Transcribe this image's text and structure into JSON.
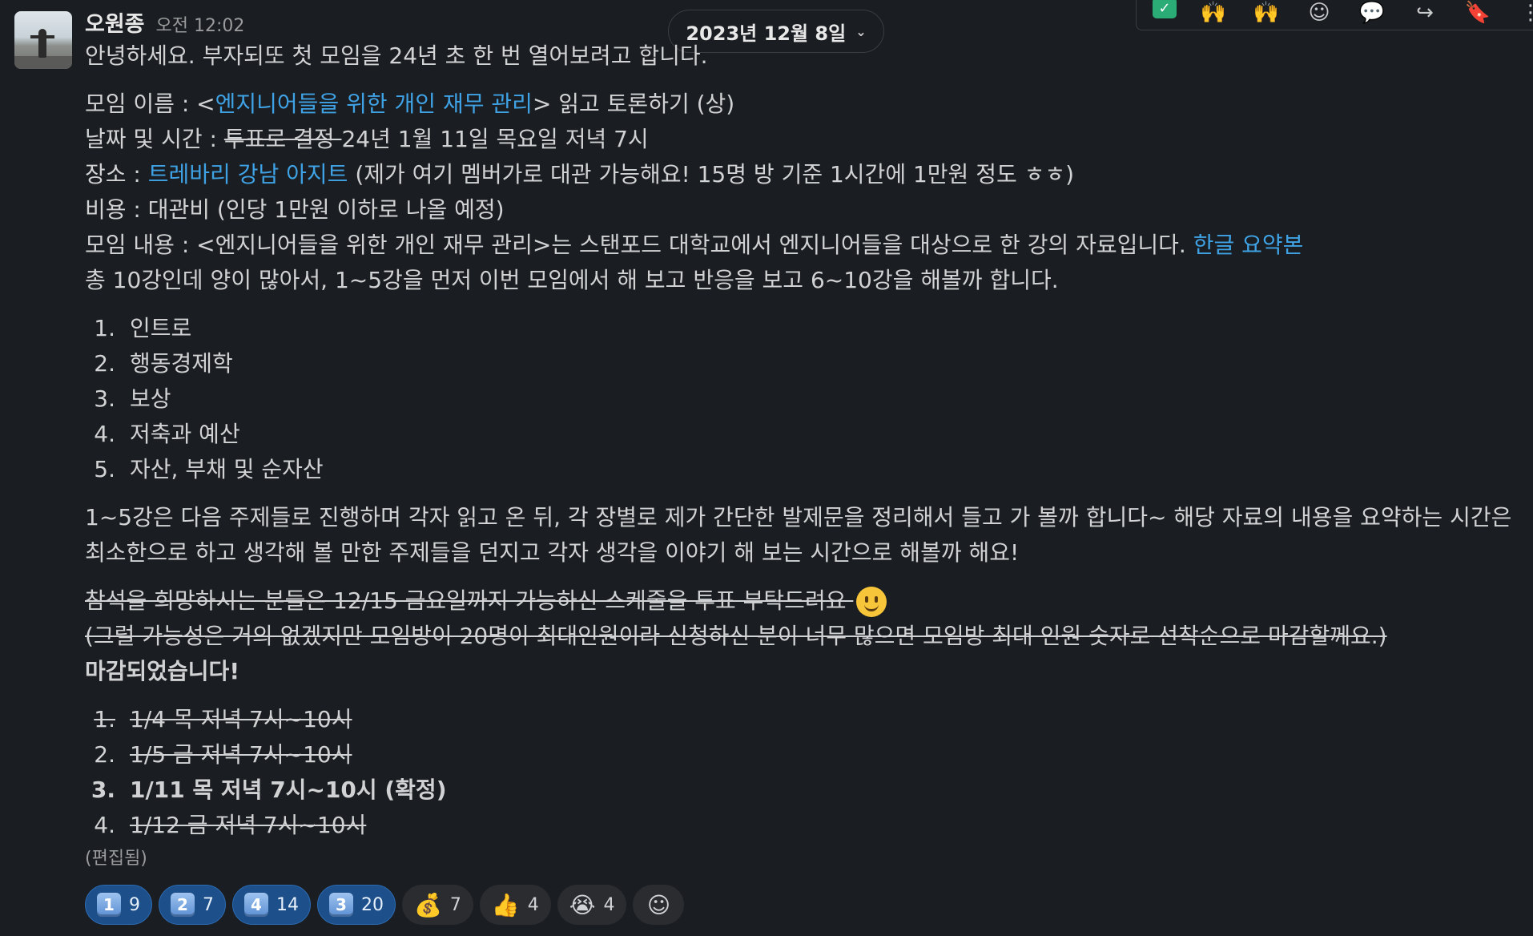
{
  "message": {
    "author": "오원종",
    "time": "오전 12:02",
    "intro": "안녕하세요. 부자되또 첫 모임을 24년 초 한 번 열어보려고 합니다.",
    "name_prefix": "모임 이름 : <",
    "name_link": "엔지니어들을 위한 개인 재무 관리",
    "name_suffix": "> 읽고 토론하기 (상)",
    "date_label": "날짜 및 시간 : ",
    "date_struck": "투표로 결정 ",
    "date_value": "24년 1월 11일 목요일 저녁 7시",
    "place_label": "장소 : ",
    "place_link": "트레바리 강남 아지트",
    "place_note": " (제가 여기 멤버가로 대관 가능해요! 15명 방 기준 1시간에 1만원 정도 ㅎㅎ)",
    "cost": "비용 : 대관비 (인당 1만원 이하로 나올 예정)",
    "content_prefix": "모임 내용 : <엔지니어들을 위한 개인 재무 관리>는 스탠포드 대학교에서 엔지니어들을 대상으로 한 강의 자료입니다. ",
    "content_link": "한글 요약본",
    "plan": "총 10강인데 양이 많아서, 1~5강을 먼저 이번 모임에서 해 보고 반응을 보고 6~10강을 해볼까 합니다.",
    "lectures": [
      {
        "num": "1.",
        "text": "인트로"
      },
      {
        "num": "2.",
        "text": "행동경제학"
      },
      {
        "num": "3.",
        "text": "보상"
      },
      {
        "num": "4.",
        "text": "저축과 예산"
      },
      {
        "num": "5.",
        "text": "자산, 부채 및 순자산"
      }
    ],
    "method": "1~5강은 다음 주제들로 진행하며 각자 읽고 온 뒤, 각 장별로 제가 간단한 발제문을 정리해서 들고 가 볼까 합니다~ 해당 자료의 내용을 요약하는 시간은 최소한으로 하고 생각해 볼 만한 주제들을 던지고 각자 생각을 이야기 해 보는 시간으로 해볼까 해요!",
    "vote_struck": "참석을 희망하시는 분들은 12/15 금요일까지 가능하신 스케줄을 투표 부탁드려요 ",
    "capacity_struck": "(그럴 가능성은 거의 없겠지만 모임방이 20명이 최대인원이라 신청하신 분이 너무 많으면 모임방 최대 인원 숫자로 선착순으로 마감할께요.)",
    "closed": "마감되었습니다!",
    "options": [
      {
        "num": "1.",
        "text": "1/4 목 저녁 7시~10시",
        "state": "struck"
      },
      {
        "num": "2.",
        "text": "1/5 금 저녁 7시~10시",
        "state": "struck"
      },
      {
        "num": "3.",
        "text": "1/11 목 저녁 7시~10시 (확정)",
        "state": "bold"
      },
      {
        "num": "4.",
        "text": "1/12 금 저녁 7시~10시",
        "state": "struck"
      }
    ],
    "edited": "(편집됨)"
  },
  "date_divider": {
    "label": "2023년 12월 8일",
    "icon": "chevron-down-icon"
  },
  "toolbar": {
    "icons": [
      "check-mark-icon",
      "raised-hands-icon",
      "celebrate-hands-icon",
      "add-reaction-icon",
      "reply-thread-icon",
      "share-icon",
      "bookmark-icon",
      "more-actions-icon"
    ]
  },
  "reactions": [
    {
      "emoji": "keycap-1",
      "glyph": "1",
      "count": "9",
      "mine": true
    },
    {
      "emoji": "keycap-2",
      "glyph": "2",
      "count": "7",
      "mine": true
    },
    {
      "emoji": "keycap-4",
      "glyph": "4",
      "count": "14",
      "mine": true
    },
    {
      "emoji": "keycap-3",
      "glyph": "3",
      "count": "20",
      "mine": true
    },
    {
      "emoji": "money-bag",
      "glyph": "💰",
      "count": "7",
      "mine": false
    },
    {
      "emoji": "thumbs-up",
      "glyph": "👍",
      "count": "4",
      "mine": false
    },
    {
      "emoji": "crying-face",
      "glyph": "😭",
      "count": "4",
      "mine": false
    }
  ],
  "colors": {
    "background": "#1a1d21",
    "link": "#3fa2e5",
    "text": "#d1d2d3",
    "reaction_active": "#1d4f8a"
  }
}
